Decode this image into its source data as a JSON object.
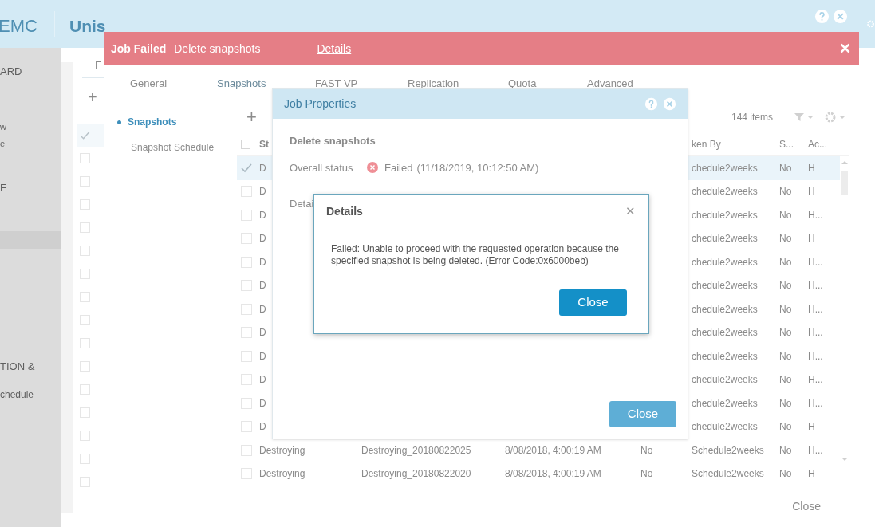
{
  "app_header": {
    "brand": "EMC",
    "product": "Unis"
  },
  "sidebar": {
    "items": [
      "ARD",
      "w",
      "e",
      "E",
      "TION &",
      "chedule"
    ]
  },
  "background_list": {
    "header": "F",
    "add": "+",
    "rows": [
      {
        "checked": true
      },
      {
        "checked": false
      },
      {
        "checked": false
      },
      {
        "checked": false
      },
      {
        "checked": false
      },
      {
        "checked": false
      },
      {
        "checked": false
      },
      {
        "checked": false
      },
      {
        "checked": false
      },
      {
        "checked": false
      },
      {
        "checked": false
      },
      {
        "checked": false
      },
      {
        "checked": false
      },
      {
        "checked": false
      },
      {
        "checked": false
      },
      {
        "checked": false
      }
    ]
  },
  "job_banner": {
    "title": "Job Failed",
    "job": "Delete snapshots",
    "link": "Details",
    "close": "✕"
  },
  "tabs": [
    {
      "label": "General",
      "selected": false
    },
    {
      "label": "Snapshots",
      "selected": true
    },
    {
      "label": "FAST VP",
      "selected": false
    },
    {
      "label": "Replication",
      "selected": false
    },
    {
      "label": "Quota",
      "selected": false
    },
    {
      "label": "Advanced",
      "selected": false
    }
  ],
  "nav": [
    {
      "label": "Snapshots",
      "selected": true
    },
    {
      "label": "Snapshot Schedule",
      "selected": false
    }
  ],
  "toolbar": {
    "add": "+",
    "count": "144 items"
  },
  "table": {
    "select_all_indeterminate": true,
    "columns": [
      "St",
      "",
      "",
      "",
      "ken By",
      "S...",
      "Ac..."
    ],
    "rows": [
      {
        "selected": true,
        "checked": true,
        "cells": [
          "D",
          "",
          "",
          "",
          "chedule2weeks",
          "No",
          "H"
        ]
      },
      {
        "selected": false,
        "checked": false,
        "cells": [
          "D",
          "",
          "",
          "",
          "chedule2weeks",
          "No",
          "H"
        ]
      },
      {
        "selected": false,
        "checked": false,
        "cells": [
          "D",
          "",
          "",
          "",
          "chedule2weeks",
          "No",
          "H..."
        ]
      },
      {
        "selected": false,
        "checked": false,
        "cells": [
          "D",
          "",
          "",
          "",
          "chedule2weeks",
          "No",
          "H"
        ]
      },
      {
        "selected": false,
        "checked": false,
        "cells": [
          "D",
          "",
          "",
          "",
          "chedule2weeks",
          "No",
          "H..."
        ]
      },
      {
        "selected": false,
        "checked": false,
        "cells": [
          "D",
          "",
          "",
          "",
          "chedule2weeks",
          "No",
          "H..."
        ]
      },
      {
        "selected": false,
        "checked": false,
        "cells": [
          "D",
          "",
          "",
          "",
          "chedule2weeks",
          "No",
          "H..."
        ]
      },
      {
        "selected": false,
        "checked": false,
        "cells": [
          "D",
          "",
          "",
          "",
          "chedule2weeks",
          "No",
          "H..."
        ]
      },
      {
        "selected": false,
        "checked": false,
        "cells": [
          "D",
          "",
          "",
          "",
          "chedule2weeks",
          "No",
          "H..."
        ]
      },
      {
        "selected": false,
        "checked": false,
        "cells": [
          "D",
          "",
          "",
          "",
          "chedule2weeks",
          "No",
          "H..."
        ]
      },
      {
        "selected": false,
        "checked": false,
        "cells": [
          "D",
          "",
          "",
          "",
          "chedule2weeks",
          "No",
          "H..."
        ]
      },
      {
        "selected": false,
        "checked": false,
        "cells": [
          "D",
          "",
          "",
          "",
          "chedule2weeks",
          "No",
          "H"
        ]
      },
      {
        "selected": false,
        "checked": false,
        "cells": [
          "Destroying",
          "Destroying_20180822025",
          "8/08/2018, 4:00:19 AM",
          "No",
          "Schedule2weeks",
          "No",
          "H..."
        ]
      },
      {
        "selected": false,
        "checked": false,
        "cells": [
          "Destroying",
          "Destroying_20180822020",
          "8/08/2018, 4:00:19 AM",
          "No",
          "Schedule2weeks",
          "No",
          "H"
        ]
      }
    ]
  },
  "footer": {
    "close": "Close"
  },
  "job_properties": {
    "title": "Job Properties",
    "job": "Delete snapshots",
    "status_label": "Overall status",
    "status": "Failed",
    "time": "(11/18/2019, 10:12:50 AM)",
    "details_label": "Detai",
    "close": "Close"
  },
  "details_dialog": {
    "title": "Details",
    "close_glyph": "✕",
    "message": "Failed: Unable to proceed with the requested operation because the specified snapshot is being deleted. (Error Code:0x6000beb)",
    "close": "Close"
  }
}
